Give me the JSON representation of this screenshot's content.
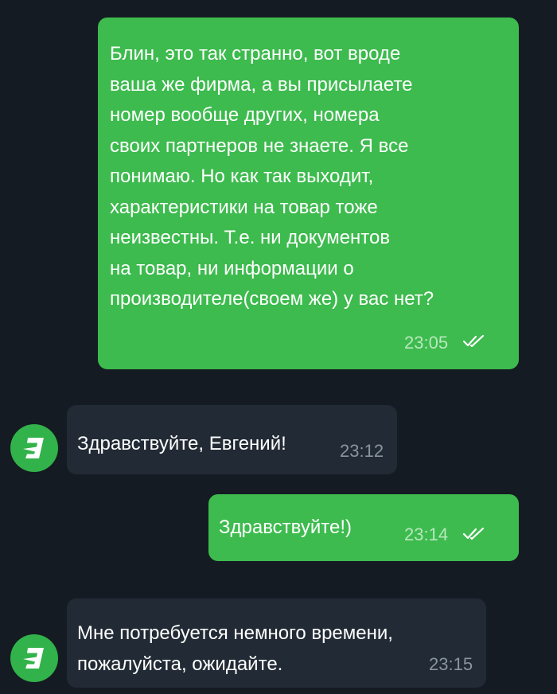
{
  "messages": [
    {
      "text": "Блин, это так странно, вот вроде\nваша же фирма, а вы присылаете\nномер вообще других, номера\nсвоих партнеров не знаете. Я все\nпонимаю. Но как так выходит,\nхарактеристики на товар тоже\nнеизвестны. Т.е. ни документов\nна товар, ни информации о\nпроизводителе(своем же) у вас нет?",
      "time": "23:05",
      "status_icon": "double-check-icon"
    },
    {
      "text": "Здравствуйте, Евгений!",
      "time": "23:12",
      "avatar_icon": "bolt-logo-icon"
    },
    {
      "text": "Здравствуйте!)",
      "time": "23:14",
      "status_icon": "double-check-icon"
    },
    {
      "text": "Мне потребуется немного времени,\nпожалуйста, ожидайте.",
      "time": "23:15",
      "avatar_icon": "bolt-logo-icon"
    }
  ],
  "colors": {
    "background": "#151b22",
    "outgoing_bubble": "#3dbb4e",
    "incoming_bubble": "#222b35",
    "avatar": "#32b24a"
  }
}
